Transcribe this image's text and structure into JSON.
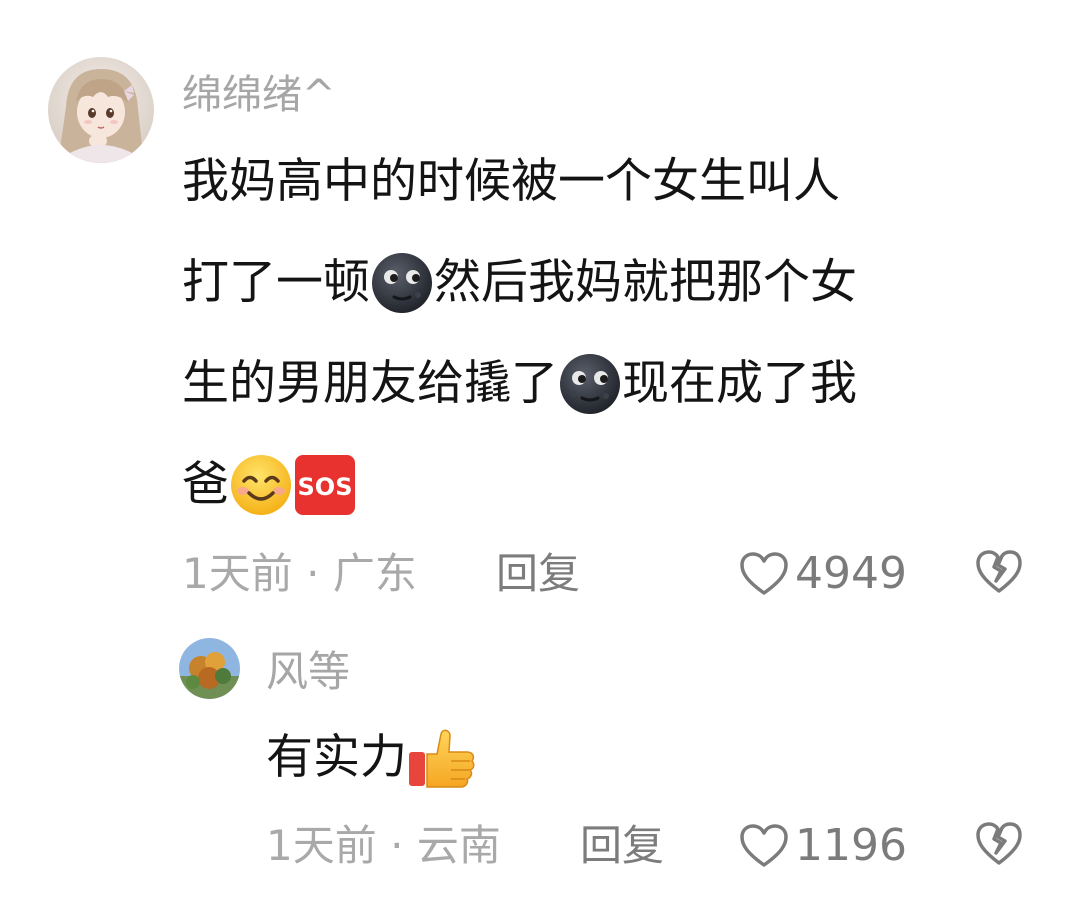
{
  "colors": {
    "username": "#a6a6a6",
    "text": "#141414",
    "meta": "#a9a9a9",
    "icon": "#7b7b7b"
  },
  "comment": {
    "username": "绵绵绪^",
    "lines": [
      [
        "我妈高中的时候被一个女生叫人"
      ],
      [
        "打了一顿",
        "new-moon-face-emoji",
        "然后我妈就把那个女"
      ],
      [
        "生的男朋友给撬了",
        "new-moon-face-emoji",
        "现在成了我"
      ],
      [
        "爸",
        "smiling-face-emoji",
        "sos-emoji"
      ]
    ],
    "line_texts": {
      "l1": "我妈高中的时候被一个女生叫人",
      "l2a": "打了一顿",
      "l2b": "然后我妈就把那个女",
      "l3a": "生的男朋友给撬了",
      "l3b": "现在成了我",
      "l4a": "爸"
    },
    "time": "1天前",
    "separator": "·",
    "location": "广东",
    "reply_label": "回复",
    "likes": "4949",
    "icons": [
      "heart-outline-icon",
      "broken-heart-icon"
    ]
  },
  "reply": {
    "username": "风等",
    "text": "有实力",
    "emoji": "thumbs-up-emoji",
    "time": "1天前",
    "separator": "·",
    "location": "云南",
    "reply_label": "回复",
    "likes": "1196",
    "icons": [
      "heart-outline-icon",
      "broken-heart-icon"
    ]
  }
}
